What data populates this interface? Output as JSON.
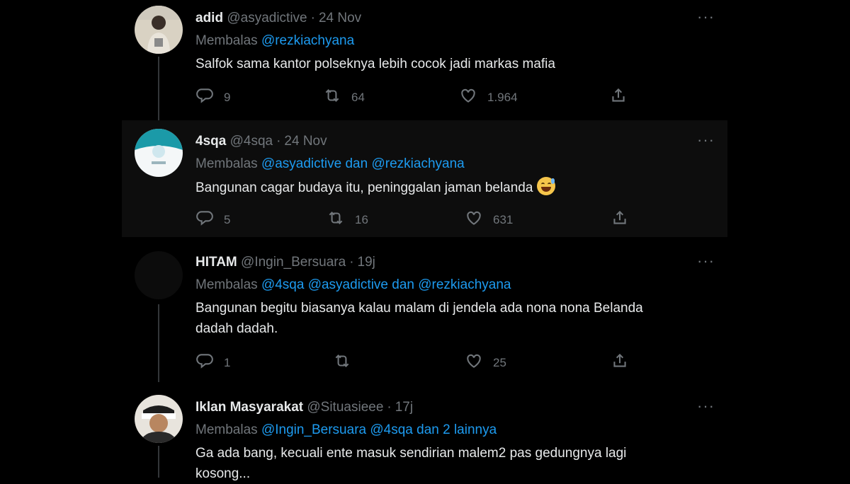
{
  "tweets": [
    {
      "name": "adid",
      "handle": "@asyadictive",
      "time": "24 Nov",
      "replying_prefix": "Membalas",
      "mentions": "@rezkiachyana",
      "text": "Salfok sama kantor polseknya lebih cocok jadi markas mafia",
      "replies": "9",
      "retweets": "64",
      "likes": "1.964"
    },
    {
      "name": "4sqa",
      "handle": "@4sqa",
      "time": "24 Nov",
      "replying_prefix": "Membalas",
      "mentions": "@asyadictive dan @rezkiachyana",
      "text": "Bangunan cagar budaya itu, peninggalan jaman belanda",
      "emoji": "grinning-sweat-emoji",
      "replies": "5",
      "retweets": "16",
      "likes": "631"
    },
    {
      "name": "HITAM",
      "handle": "@Ingin_Bersuara",
      "time": "19j",
      "replying_prefix": "Membalas",
      "mentions": "@4sqa @asyadictive dan @rezkiachyana",
      "text_line1": "Bangunan begitu biasanya kalau malam di jendela ada nona nona Belanda",
      "text_line2": "dadah dadah.",
      "replies": "1",
      "retweets": "",
      "likes": "25"
    },
    {
      "name": "Iklan Masyarakat",
      "handle": "@Situasieee",
      "time": "17j",
      "replying_prefix": "Membalas",
      "mentions": "@Ingin_Bersuara @4sqa  dan 2 lainnya",
      "text_line1": "Ga ada bang, kecuali ente masuk sendirian malem2 pas gedungnya lagi",
      "text_line2": "kosong..."
    }
  ],
  "more_glyph": "···",
  "dot": "·",
  "colors": {
    "background": "#000000",
    "accent": "#1d9bf0",
    "muted": "#71767b",
    "text": "#e7e9ea"
  }
}
